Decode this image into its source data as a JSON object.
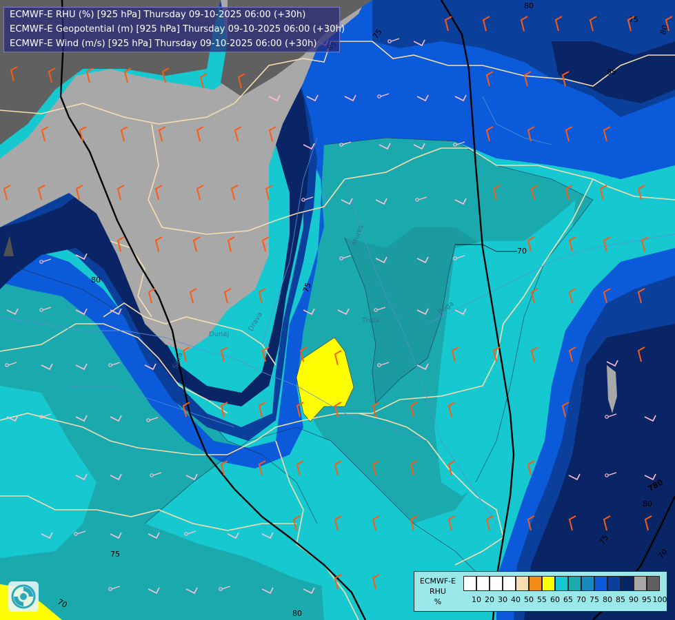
{
  "title_lines": [
    "ECMWF-E RHU (%) [925 hPa] Thursday 09-10-2025 06:00 (+30h)",
    "ECMWF-E Geopotential (m) [925 hPa] Thursday 09-10-2025 06:00 (+30h)",
    "ECMWF-E Wind (m/s) [925 hPa] Thursday 09-10-2025 06:00 (+30h)"
  ],
  "legend": {
    "title_lines": [
      "ECMWF-E",
      "RHU",
      "%"
    ],
    "ticks": [
      "10",
      "20",
      "30",
      "40",
      "50",
      "55",
      "60",
      "65",
      "70",
      "75",
      "80",
      "85",
      "90",
      "95",
      "100"
    ],
    "colors": [
      "#ffffff",
      "#ffffff",
      "#ffffff",
      "#ffffff",
      "#f7deb0",
      "#f28c14",
      "#ffff00",
      "#16c8cf",
      "#1aa9ad",
      "#1a89c2",
      "#0b5ad9",
      "#0a3f9b",
      "#0a2566",
      "#a8a8a8",
      "#606060"
    ]
  },
  "contour_labels": [
    "80",
    "85",
    "75",
    "80",
    "85",
    "75",
    "70",
    "80",
    "75",
    "70",
    "75",
    "80",
    "70",
    "80",
    "780"
  ],
  "place_labels": [
    "Sava",
    "Drava",
    "Dunaj",
    "Tisza",
    "Béga",
    "Mures"
  ],
  "colors": {
    "rhu_95": "#a8a8a8",
    "rhu_100": "#606060",
    "rhu_90": "#0a2566",
    "rhu_85": "#0a3f9b",
    "rhu_80": "#0b5ad9",
    "rhu_75": "#1aa9ad",
    "rhu_70": "#16c8cf",
    "rhu_65": "#ffff00",
    "wind_strong": "#ff5a10",
    "wind_light": "#ffc0d6",
    "border": "#f7deb0",
    "isohypse": "#000000"
  },
  "wind_barbs": {
    "strong": [
      [
        20,
        118
      ],
      [
        75,
        120
      ],
      [
        130,
        120
      ],
      [
        185,
        120
      ],
      [
        240,
        120
      ],
      [
        295,
        128
      ],
      [
        350,
        128
      ],
      [
        65,
        205
      ],
      [
        120,
        205
      ],
      [
        180,
        205
      ],
      [
        235,
        205
      ],
      [
        290,
        205
      ],
      [
        345,
        205
      ],
      [
        395,
        205
      ],
      [
        10,
        290
      ],
      [
        60,
        290
      ],
      [
        115,
        290
      ],
      [
        175,
        290
      ],
      [
        230,
        290
      ],
      [
        290,
        290
      ],
      [
        340,
        290
      ],
      [
        390,
        290
      ],
      [
        175,
        365
      ],
      [
        230,
        365
      ],
      [
        285,
        365
      ],
      [
        335,
        365
      ],
      [
        385,
        365
      ],
      [
        220,
        440
      ],
      [
        280,
        440
      ],
      [
        330,
        440
      ],
      [
        380,
        440
      ],
      [
        270,
        525
      ],
      [
        325,
        525
      ],
      [
        385,
        525
      ],
      [
        440,
        525
      ],
      [
        490,
        530
      ],
      [
        270,
        605
      ],
      [
        325,
        605
      ],
      [
        380,
        605
      ],
      [
        435,
        605
      ],
      [
        490,
        605
      ],
      [
        545,
        605
      ],
      [
        600,
        605
      ],
      [
        655,
        605
      ],
      [
        325,
        690
      ],
      [
        380,
        690
      ],
      [
        435,
        690
      ],
      [
        490,
        690
      ],
      [
        545,
        690
      ],
      [
        600,
        690
      ],
      [
        655,
        690
      ],
      [
        430,
        770
      ],
      [
        490,
        770
      ],
      [
        545,
        770
      ],
      [
        600,
        770
      ],
      [
        655,
        770
      ],
      [
        710,
        770
      ],
      [
        490,
        855
      ],
      [
        545,
        855
      ],
      [
        710,
        125
      ],
      [
        765,
        125
      ],
      [
        820,
        125
      ],
      [
        710,
        205
      ],
      [
        770,
        205
      ],
      [
        825,
        205
      ],
      [
        880,
        205
      ],
      [
        720,
        290
      ],
      [
        775,
        290
      ],
      [
        825,
        290
      ],
      [
        875,
        290
      ],
      [
        930,
        290
      ],
      [
        770,
        365
      ],
      [
        830,
        365
      ],
      [
        880,
        365
      ],
      [
        935,
        365
      ],
      [
        775,
        440
      ],
      [
        830,
        440
      ],
      [
        880,
        440
      ],
      [
        930,
        440
      ],
      [
        660,
        525
      ],
      [
        720,
        525
      ],
      [
        775,
        525
      ],
      [
        830,
        525
      ],
      [
        930,
        525
      ],
      [
        820,
        605
      ],
      [
        770,
        690
      ],
      [
        770,
        770
      ],
      [
        830,
        770
      ],
      [
        880,
        770
      ],
      [
        940,
        770
      ],
      [
        650,
        45
      ],
      [
        705,
        45
      ],
      [
        760,
        45
      ],
      [
        810,
        45
      ],
      [
        860,
        45
      ],
      [
        915,
        45
      ],
      [
        970,
        45
      ]
    ],
    "light": [
      [
        60,
        380
      ],
      [
        110,
        370
      ],
      [
        10,
        450
      ],
      [
        60,
        450
      ],
      [
        110,
        450
      ],
      [
        160,
        450
      ],
      [
        10,
        530
      ],
      [
        60,
        530
      ],
      [
        110,
        530
      ],
      [
        160,
        530
      ],
      [
        210,
        530
      ],
      [
        10,
        605
      ],
      [
        60,
        605
      ],
      [
        110,
        605
      ],
      [
        160,
        605
      ],
      [
        215,
        610
      ],
      [
        110,
        690
      ],
      [
        160,
        690
      ],
      [
        220,
        690
      ],
      [
        270,
        690
      ],
      [
        60,
        775
      ],
      [
        110,
        775
      ],
      [
        160,
        775
      ],
      [
        215,
        775
      ],
      [
        270,
        775
      ],
      [
        330,
        775
      ],
      [
        380,
        775
      ],
      [
        160,
        855
      ],
      [
        215,
        855
      ],
      [
        270,
        855
      ],
      [
        320,
        855
      ],
      [
        380,
        855
      ],
      [
        440,
        855
      ],
      [
        440,
        290
      ],
      [
        495,
        290
      ],
      [
        545,
        290
      ],
      [
        605,
        290
      ],
      [
        660,
        290
      ],
      [
        440,
        210
      ],
      [
        495,
        210
      ],
      [
        550,
        210
      ],
      [
        600,
        210
      ],
      [
        660,
        210
      ],
      [
        445,
        140
      ],
      [
        500,
        140
      ],
      [
        550,
        140
      ],
      [
        605,
        140
      ],
      [
        660,
        140
      ],
      [
        495,
        375
      ],
      [
        545,
        375
      ],
      [
        605,
        375
      ],
      [
        660,
        375
      ],
      [
        440,
        450
      ],
      [
        490,
        450
      ],
      [
        545,
        450
      ],
      [
        605,
        450
      ],
      [
        660,
        450
      ],
      [
        550,
        530
      ],
      [
        605,
        530
      ],
      [
        880,
        525
      ],
      [
        880,
        605
      ],
      [
        935,
        605
      ],
      [
        825,
        690
      ],
      [
        880,
        690
      ],
      [
        935,
        690
      ],
      [
        390,
        140
      ],
      [
        565,
        60
      ],
      [
        600,
        60
      ],
      [
        460,
        60
      ]
    ]
  }
}
